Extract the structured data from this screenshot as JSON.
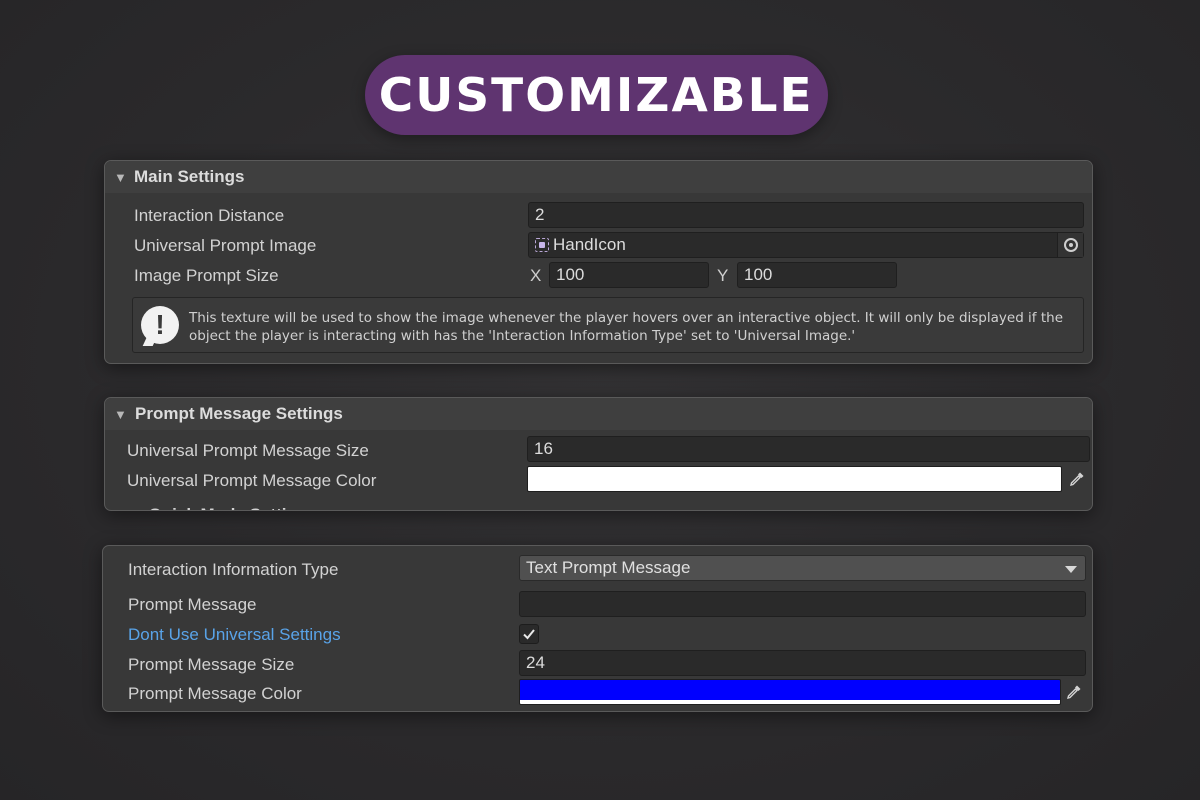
{
  "banner": {
    "title": "CUSTOMIZABLE",
    "color": "#5f3470"
  },
  "main_settings": {
    "header": "Main Settings",
    "interaction_distance": {
      "label": "Interaction Distance",
      "value": "2"
    },
    "universal_prompt_image": {
      "label": "Universal Prompt Image",
      "value": "HandIcon"
    },
    "image_prompt_size": {
      "label": "Image Prompt Size",
      "x_label": "X",
      "x_value": "100",
      "y_label": "Y",
      "y_value": "100"
    },
    "help_text": "This texture will be used to show the image whenever the player hovers over an interactive object. It will only be displayed if the object the player is interacting with has the 'Interaction Information Type' set to 'Universal Image.'"
  },
  "prompt_message_settings": {
    "header": "Prompt Message Settings",
    "message_size": {
      "label": "Universal Prompt Message Size",
      "value": "16"
    },
    "message_color": {
      "label": "Universal Prompt Message Color",
      "color": "#ffffff"
    }
  },
  "object_settings": {
    "interaction_information_type": {
      "label": "Interaction Information Type",
      "value": "Text Prompt Message"
    },
    "prompt_message": {
      "label": "Prompt Message",
      "value": ""
    },
    "dont_use_universal": {
      "label": "Dont Use Universal Settings",
      "checked": true
    },
    "prompt_message_size": {
      "label": "Prompt Message Size",
      "value": "24"
    },
    "prompt_message_color": {
      "label": "Prompt Message Color",
      "color": "#0000ff"
    }
  },
  "icons": [
    "foldout-arrow-icon",
    "object-field-icon",
    "object-picker-icon",
    "info-icon",
    "eyedropper-icon",
    "dropdown-arrow-icon",
    "checkmark-icon"
  ]
}
